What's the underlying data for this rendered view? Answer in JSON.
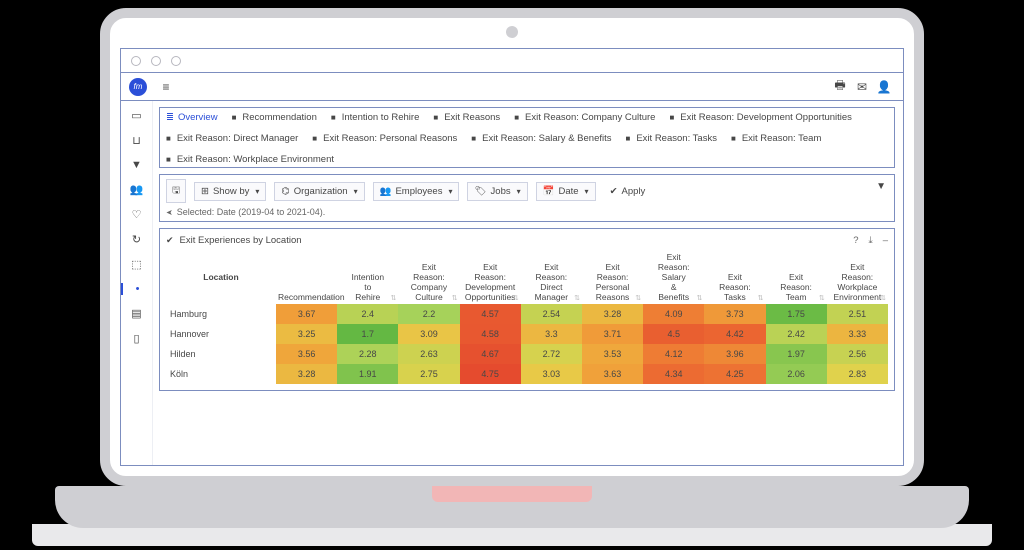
{
  "brand": {
    "logo_text": "fm"
  },
  "sidebar_icons": [
    "▭",
    "⊔",
    "▼",
    "👥",
    "♡",
    "↻",
    "⬚",
    "•",
    "▤",
    "▯"
  ],
  "top_icons": {
    "menu": "≡",
    "print": "🖶",
    "mail": "✉",
    "user": "👤"
  },
  "tabs": [
    {
      "label": "Overview",
      "active": true,
      "icon": "overview"
    },
    {
      "label": "Recommendation"
    },
    {
      "label": "Intention to Rehire"
    },
    {
      "label": "Exit Reasons"
    },
    {
      "label": "Exit Reason: Company Culture"
    },
    {
      "label": "Exit Reason: Development Opportunities"
    },
    {
      "label": "Exit Reason: Direct Manager"
    },
    {
      "label": "Exit Reason: Personal Reasons"
    },
    {
      "label": "Exit Reason: Salary & Benefits"
    },
    {
      "label": "Exit Reason: Tasks"
    },
    {
      "label": "Exit Reason: Team"
    },
    {
      "label": "Exit Reason: Workplace Environment"
    }
  ],
  "filters": {
    "save_icon": "🖫",
    "showby": {
      "icon": "⊞",
      "label": "Show by"
    },
    "organization": {
      "icon": "⌬",
      "label": "Organization"
    },
    "employees": {
      "icon": "👥",
      "label": "Employees"
    },
    "jobs": {
      "icon": "🏷",
      "label": "Jobs"
    },
    "date": {
      "icon": "📅",
      "label": "Date"
    },
    "apply": {
      "icon": "✔",
      "label": "Apply"
    },
    "selected_label": "Selected: Date (2019-04 to 2021-04).",
    "funnel": "▼"
  },
  "panel": {
    "title": "Exit Experiences by Location",
    "help": "?",
    "download": "⤓",
    "collapse": "–"
  },
  "table": {
    "head": [
      "Location",
      "Recommendation",
      "Intention to Rehire",
      "Exit Reason: Company Culture",
      "Exit Reason: Development Opportunities",
      "Exit Reason: Direct Manager",
      "Exit Reason: Personal Reasons",
      "Exit Reason: Salary & Benefits",
      "Exit Reason: Tasks",
      "Exit Reason: Team",
      "Exit Reason: Workplace Environment"
    ],
    "rows": [
      {
        "loc": "Hamburg",
        "v": [
          3.67,
          2.4,
          2.2,
          4.57,
          2.54,
          3.28,
          4.09,
          3.73,
          1.75,
          2.51
        ]
      },
      {
        "loc": "Hannover",
        "v": [
          3.25,
          1.7,
          3.09,
          4.58,
          3.3,
          3.71,
          4.5,
          4.42,
          2.42,
          3.33
        ]
      },
      {
        "loc": "Hilden",
        "v": [
          3.56,
          2.28,
          2.63,
          4.67,
          2.72,
          3.53,
          4.12,
          3.96,
          1.97,
          2.56
        ]
      },
      {
        "loc": "Köln",
        "v": [
          3.28,
          1.91,
          2.75,
          4.75,
          3.03,
          3.63,
          4.34,
          4.25,
          2.06,
          2.83
        ]
      }
    ]
  },
  "chart_data": {
    "type": "heatmap",
    "title": "Exit Experiences by Location",
    "ylabel": "Location",
    "rows": [
      "Hamburg",
      "Hannover",
      "Hilden",
      "Köln"
    ],
    "columns": [
      "Recommendation",
      "Intention to Rehire",
      "Exit Reason: Company Culture",
      "Exit Reason: Development Opportunities",
      "Exit Reason: Direct Manager",
      "Exit Reason: Personal Reasons",
      "Exit Reason: Salary & Benefits",
      "Exit Reason: Tasks",
      "Exit Reason: Team",
      "Exit Reason: Workplace Environment"
    ],
    "values": [
      [
        3.67,
        2.4,
        2.2,
        4.57,
        2.54,
        3.28,
        4.09,
        3.73,
        1.75,
        2.51
      ],
      [
        3.25,
        1.7,
        3.09,
        4.58,
        3.3,
        3.71,
        4.5,
        4.42,
        2.42,
        3.33
      ],
      [
        3.56,
        2.28,
        2.63,
        4.67,
        2.72,
        3.53,
        4.12,
        3.96,
        1.97,
        2.56
      ],
      [
        3.28,
        1.91,
        2.75,
        4.75,
        3.03,
        3.63,
        4.34,
        4.25,
        2.06,
        2.83
      ]
    ],
    "value_range": [
      1.5,
      5.0
    ],
    "color_scale": [
      "#4aae3a",
      "#a6d25a",
      "#e6d24a",
      "#f0a33a",
      "#ed6e32",
      "#e0382c"
    ]
  },
  "heat_colors": {
    "min": 1.5,
    "max": 5.0,
    "stops": [
      "#4aae3a",
      "#a6d25a",
      "#e6d24a",
      "#f0a33a",
      "#ed6e32",
      "#e0382c"
    ]
  }
}
